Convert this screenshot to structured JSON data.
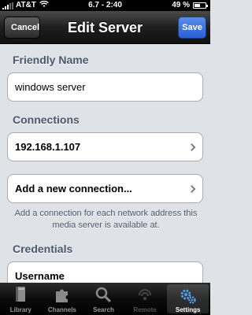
{
  "status_bar": {
    "carrier": "AT&T",
    "time": "6.7 - 2:40",
    "battery_text": "49 %",
    "battery_level": 0.49
  },
  "navbar": {
    "title": "Edit Server",
    "cancel_label": "Cancel",
    "save_label": "Save"
  },
  "sections": {
    "friendly_name": {
      "header": "Friendly Name",
      "value": "windows server"
    },
    "connections": {
      "header": "Connections",
      "items": [
        "192.168.1.107"
      ],
      "add_label": "Add a new connection...",
      "footnote": "Add a connection for each network address this media server is available at."
    },
    "credentials": {
      "header": "Credentials",
      "username_label": "Username"
    }
  },
  "tabbar": {
    "tabs": [
      {
        "label": "Library",
        "icon": "book-icon"
      },
      {
        "label": "Channels",
        "icon": "puzzle-icon"
      },
      {
        "label": "Search",
        "icon": "magnifier-icon"
      },
      {
        "label": "Remote",
        "icon": "remote-icon"
      },
      {
        "label": "Settings",
        "icon": "gears-icon"
      }
    ],
    "selected": "Settings"
  }
}
